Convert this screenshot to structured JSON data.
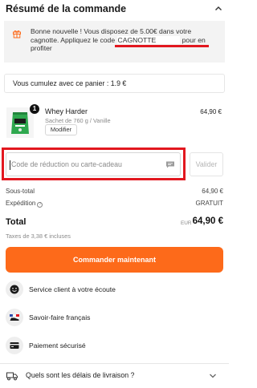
{
  "summary": {
    "title": "Résumé de la commande",
    "collapse_icon": "chevron-up-icon"
  },
  "promo": {
    "icon": "gift-icon",
    "text_before": "Bonne nouvelle ! Vous disposez de 5.00€ dans votre cagnotte. Appliquez le code ",
    "code": "CAGNOTTE",
    "text_after": " pour en profiter"
  },
  "cart_points": {
    "text": "Vous cumulez avec ce panier : 1.9 €"
  },
  "product": {
    "quantity": "1",
    "name": "Whey Harder",
    "variant": "Sachet de 760 g / Vanille",
    "modify_label": "Modifier",
    "price": "64,90 €"
  },
  "discount": {
    "placeholder": "Code de réduction ou carte-cadeau",
    "validate_label": "Valider",
    "icon": "chat-bubble-icon"
  },
  "totals": {
    "subtotal_label": "Sous-total",
    "subtotal_value": "64,90 €",
    "shipping_label": "Expédition",
    "shipping_value": "GRATUIT",
    "total_label": "Total",
    "currency": "EUR",
    "total_value": "64,90 €",
    "tax_note": "Taxes de 3,38 € incluses"
  },
  "cta": {
    "order_label": "Commander maintenant"
  },
  "features": [
    {
      "icon": "smiley-icon",
      "label": "Service client à votre écoute"
    },
    {
      "icon": "french-flag-shoe-icon",
      "label": "Savoir-faire français"
    },
    {
      "icon": "credit-card-icon",
      "label": "Paiement sécurisé"
    }
  ],
  "faq": {
    "icon": "truck-icon",
    "label": "Quels sont les délais de livraison ?",
    "expand_icon": "chevron-down-icon"
  },
  "colors": {
    "accent": "#fd6a1a",
    "highlight_red": "#e2171f",
    "promo_bg": "#f3f3f3",
    "product_green": "#2fa84f"
  }
}
